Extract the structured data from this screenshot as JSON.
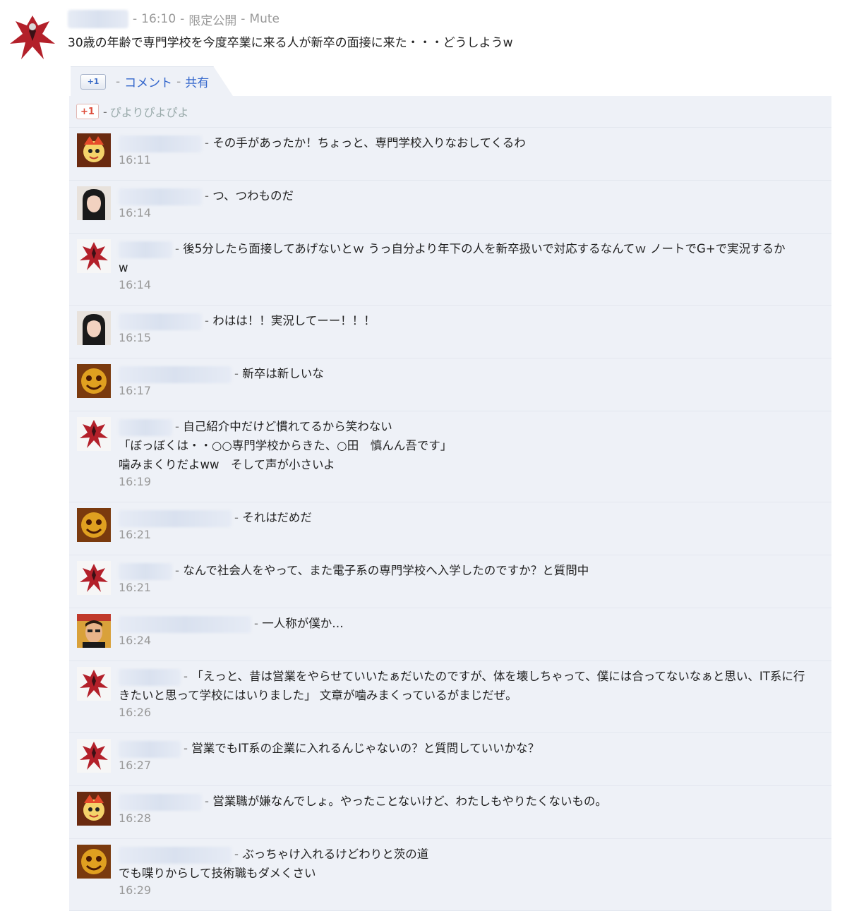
{
  "post": {
    "time": "16:10",
    "visibility": "限定公開",
    "mute": "Mute",
    "text": "30歳の年齢で専門学校を今度卒業に来る人が新卒の面接に来た・・・どうしようw"
  },
  "actions": {
    "plusone": "+1",
    "comment": "コメント",
    "share": "共有"
  },
  "plusones": {
    "badge": "+1",
    "names": "ぴよりぴよぴよ"
  },
  "comments": [
    {
      "avatar": "kid",
      "lines": [
        "その手があったか！ちょっと、専門学校入りなおしてくるわ"
      ],
      "time": "16:11"
    },
    {
      "avatar": "woman",
      "lines": [
        "つ、つわものだ"
      ],
      "time": "16:14"
    },
    {
      "avatar": "red",
      "lines": [
        "後5分したら面接してあげないとｗ うっ自分より年下の人を新卒扱いで対応するなんてｗ ノートでG+で実況するか",
        "w"
      ],
      "time": "16:14"
    },
    {
      "avatar": "woman",
      "lines": [
        "わはは！！実況してーー！！！"
      ],
      "time": "16:15"
    },
    {
      "avatar": "gold",
      "lines": [
        "新卒は新しいな"
      ],
      "time": "16:17"
    },
    {
      "avatar": "red",
      "lines": [
        "自己紹介中だけど慣れてるから笑わない",
        "「ぼっぼくは・・○○専門学校からきた、○田　慎んん吾です」",
        "噛みまくりだよww　そして声が小さいよ"
      ],
      "time": "16:19"
    },
    {
      "avatar": "gold",
      "lines": [
        "それはだめだ"
      ],
      "time": "16:21"
    },
    {
      "avatar": "red",
      "lines": [
        "なんで社会人をやって、また電子系の専門学校へ入学したのですか？と質問中"
      ],
      "time": "16:21"
    },
    {
      "avatar": "man",
      "lines": [
        "一人称が僕か…"
      ],
      "time": "16:24"
    },
    {
      "avatar": "red",
      "lines": [
        "「えっと、昔は営業をやらせていいたぁだいたのですが、体を壊しちゃって、僕には合ってないなぁと思い、IT系に行",
        "きたいと思って学校にはいりました」 文章が噛みまくっているがまじだぜ。"
      ],
      "time": "16:26"
    },
    {
      "avatar": "red",
      "lines": [
        "営業でもIT系の企業に入れるんじゃないの？と質問していいかな？"
      ],
      "time": "16:27"
    },
    {
      "avatar": "kid",
      "lines": [
        "営業職が嫌なんでしょ。やったことないけど、わたしもやりたくないもの。"
      ],
      "time": "16:28"
    },
    {
      "avatar": "gold",
      "lines": [
        "ぶっちゃけ入れるけどわりと茨の道",
        "でも喋りからして技術職もダメくさい"
      ],
      "time": "16:29"
    }
  ]
}
